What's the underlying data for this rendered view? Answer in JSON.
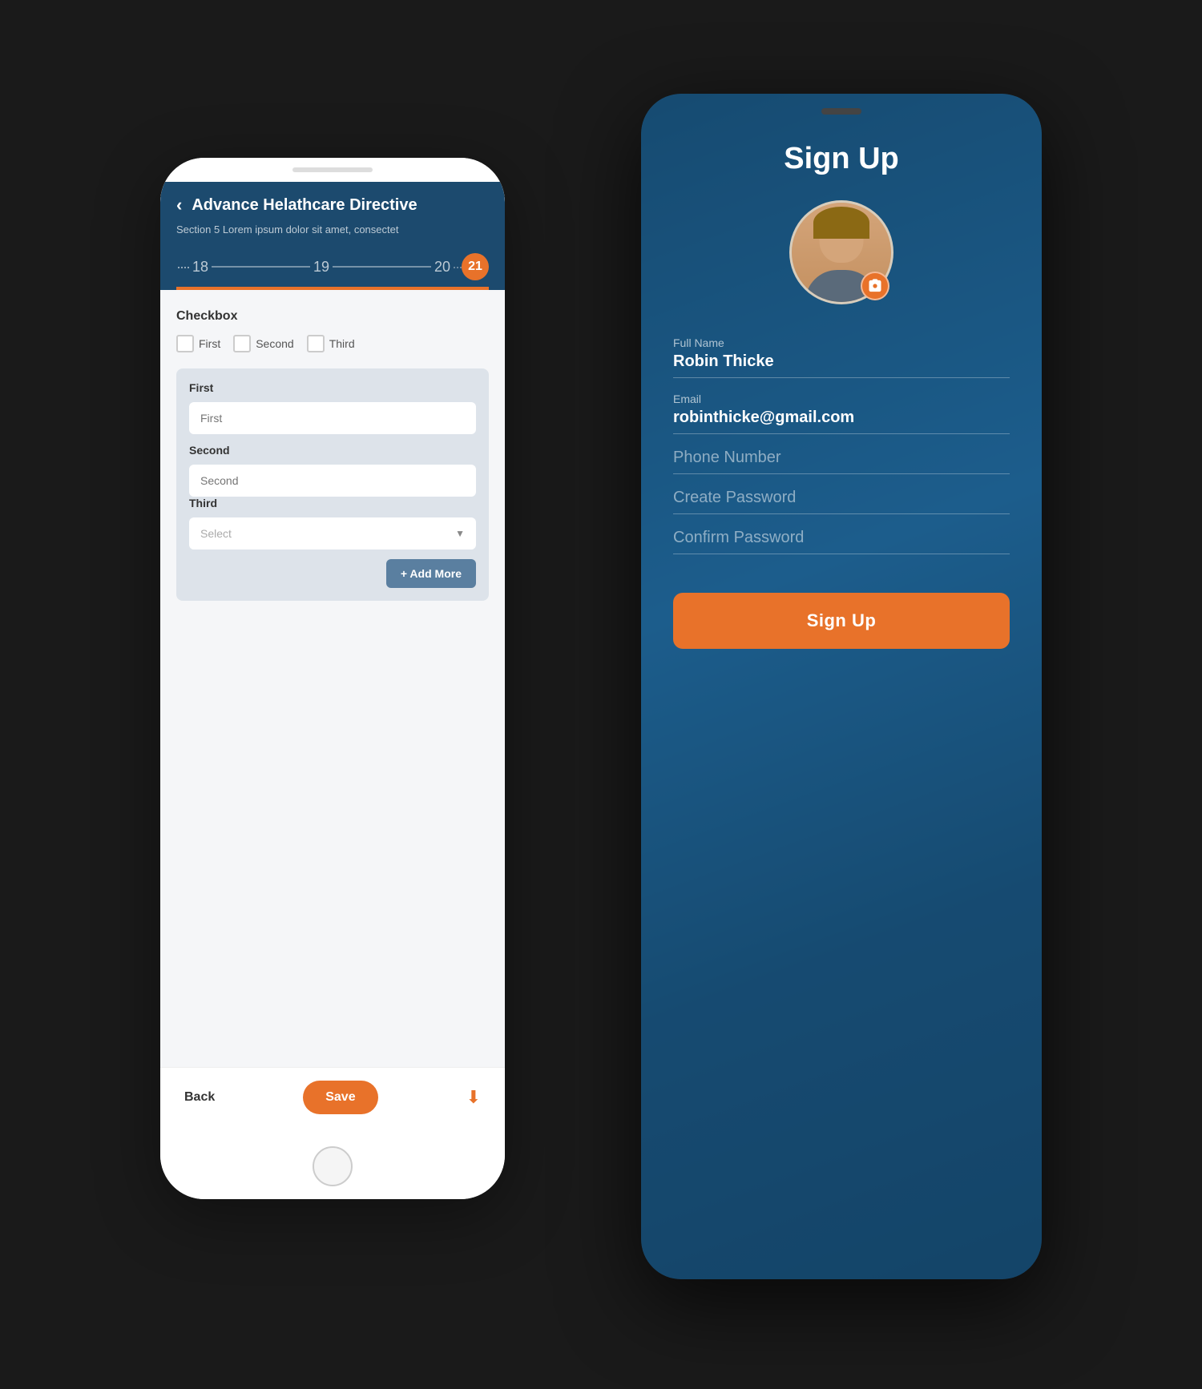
{
  "left_phone": {
    "header": {
      "back_label": "‹",
      "title": "Advance Helathcare Directive",
      "subtitle": "Section 5 Lorem ipsum dolor sit amet, consectet",
      "progress": {
        "dots_left": "····",
        "step1": "18",
        "step2": "19",
        "step3": "20",
        "dots_right": "···",
        "active_step": "21"
      }
    },
    "checkbox_section": {
      "label": "Checkbox",
      "items": [
        {
          "label": "First"
        },
        {
          "label": "Second"
        },
        {
          "label": "Third"
        }
      ]
    },
    "group_card": {
      "fields": [
        {
          "label": "First",
          "input_placeholder": "First",
          "type": "text"
        },
        {
          "label": "Second",
          "input_placeholder": "Second",
          "type": "text"
        },
        {
          "label": "Third",
          "input_placeholder": "Select",
          "type": "select"
        }
      ],
      "add_more_label": "+ Add More"
    },
    "bottom_nav": {
      "back_label": "Back",
      "save_label": "Save",
      "download_icon": "⬇"
    }
  },
  "right_phone": {
    "speaker": "",
    "title": "Sign Up",
    "avatar": {
      "camera_icon": "📷"
    },
    "form": {
      "full_name_label": "Full Name",
      "full_name_value": "Robin Thicke",
      "email_label": "Email",
      "email_value": "robinthicke@gmail.com",
      "phone_label": "Phone Number",
      "phone_placeholder": "Phone Number",
      "create_password_label": "Create Password",
      "create_password_placeholder": "Create Password",
      "confirm_password_label": "Confirm Password",
      "confirm_password_placeholder": "Confirm Password"
    },
    "signup_button_label": "Sign Up"
  },
  "colors": {
    "orange": "#e8722a",
    "dark_blue": "#1c4a6e",
    "medium_blue": "#2980b9",
    "steel_blue": "#5a7fa0",
    "light_gray": "#f5f6f8",
    "card_bg": "#dde3ea"
  }
}
